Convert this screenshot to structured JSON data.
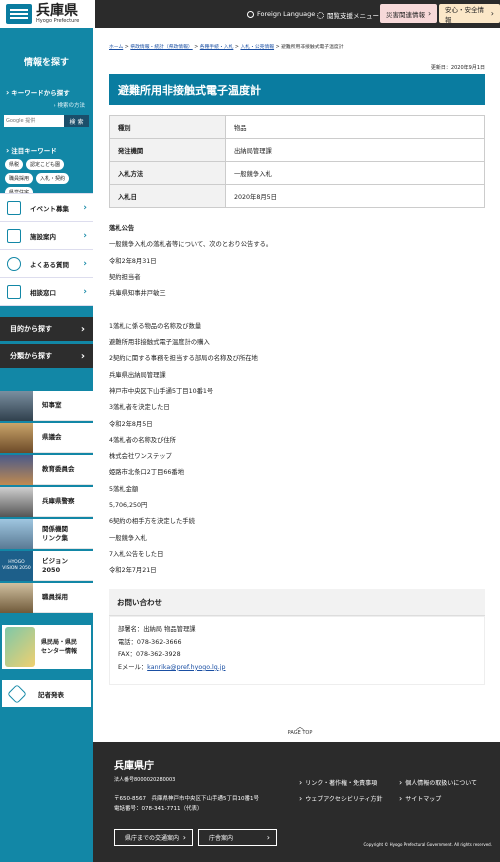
{
  "header": {
    "logo_jp": "兵庫県",
    "logo_en": "Hyogo Prefecture",
    "foreign": "Foreign Language",
    "support": "閲覧支援メニュー",
    "disaster": "災害関連情報",
    "safety": "安心・安全情報"
  },
  "sidebar": {
    "title": "情報を探す",
    "kw_label": "キーワードから探す",
    "search_method": "検索の方法",
    "search_placeholder": "Google 提供",
    "search_btn": "検 索",
    "attn_label": "注目キーワード",
    "keywords": [
      "県税",
      "認定こども園",
      "職員採用",
      "入札・契約",
      "県営住宅"
    ],
    "menu": [
      "イベント募集",
      "施設案内",
      "よくある質問",
      "相談窓口"
    ],
    "purpose": "目的から探す",
    "category": "分類から探す",
    "links": [
      "知事室",
      "県議会",
      "教育委員会",
      "兵庫県警察",
      "関係機関\nリンク集",
      "ビジョン\n2050",
      "職員採用"
    ],
    "vision_text": "HYOGO VISION 2050",
    "special": "県民局・県民\nセンター情報",
    "press": "記者発表"
  },
  "breadcrumb": [
    "ホーム",
    "県政情報・統計（県政情報）",
    "各種手続・入札",
    "入札・公売情報",
    "避難所用非接触式電子温度計"
  ],
  "updated": "更新日：2020年9月1日",
  "title": "避難所用非接触式電子温度計",
  "table": [
    [
      "種別",
      "物品"
    ],
    [
      "発注機関",
      "出納局管理課"
    ],
    [
      "入札方法",
      "一般競争入札"
    ],
    [
      "入札日",
      "2020年8月5日"
    ]
  ],
  "body": [
    "落札公告",
    "一般競争入札の落札者等について、次のとおり公告する。",
    "令和2年8月31日",
    "契約担当者",
    "兵庫県知事井戸敏三",
    "",
    "1落札に係る物品の名称及び数量",
    "避難所用非接触式電子温度計の購入",
    "2契約に関する事務を担当する部局の名称及び所在地",
    "兵庫県出納局管理課",
    "神戸市中央区下山手通5丁目10番1号",
    "3落札者を決定した日",
    "令和2年8月5日",
    "4落札者の名称及び住所",
    "株式会社ワンステップ",
    "姫路市北条口2丁目66番地",
    "5落札金額",
    "5,706,250円",
    "6契約の相手方を決定した手続",
    "一般競争入札",
    "7入札公告をした日",
    "令和2年7月21日"
  ],
  "contact": {
    "title": "お問い合わせ",
    "dept": "部署名：出納局 物品管理課",
    "tel": "電話：078-362-3666",
    "fax": "FAX：078-362-3928",
    "email_label": "Eメール：",
    "email": "kanrika@pref.hyogo.lg.jp"
  },
  "pagetop": "PAGE TOP",
  "footer": {
    "name": "兵庫県庁",
    "corp_no": "法人番号8000020280003",
    "address": "〒650-8567　兵庫県神戸市中央区下山手通5丁目10番1号",
    "phone": "電話番号：078-341-7711（代表）",
    "access": "県庁までの交通案内",
    "guide": "庁舎案内",
    "links": [
      "リンク・著作権・免責事項",
      "個人情報の取扱いについて",
      "ウェブアクセシビリティ方針",
      "サイトマップ"
    ],
    "copyright": "Copyright © Hyogo Prefectural Government. All rights reserved."
  }
}
